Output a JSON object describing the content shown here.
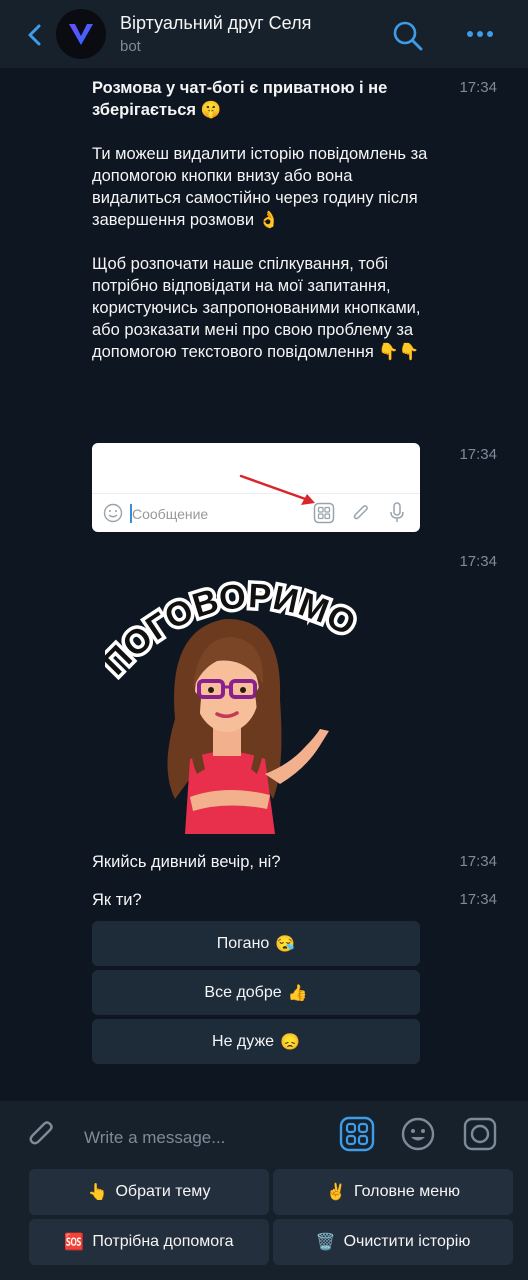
{
  "header": {
    "title": "Віртуальний друг Селя",
    "subtitle": "bot"
  },
  "messages": {
    "m1": {
      "bold_line": "Розмова у чат-боті є приватною і не зберігається 🤫",
      "para2": "Ти можеш видалити історію повідомлень за допомогою кнопки внизу або вона видалиться самостійно через годину після завершення розмови 👌",
      "para3": "Щоб розпочати наше спілкування, тобі потрібно відповідати на мої запитання, користуючись запропонованими кнопками, або розказати мені про свою проблему за допомогою текстового повідомлення 👇👇",
      "time": "17:34"
    },
    "screenshot": {
      "placeholder": "Сообщение",
      "time": "17:34"
    },
    "sticker": {
      "caption": "ПОГОВОРИМО?",
      "time": "17:34"
    },
    "m4": {
      "text": "Якийсь дивний вечір, ні?",
      "time": "17:34"
    },
    "m5": {
      "text": "Як ти?",
      "time": "17:34"
    }
  },
  "inline_keyboard": [
    {
      "label": "Погано",
      "emoji": "😪"
    },
    {
      "label": "Все добре",
      "emoji": "👍"
    },
    {
      "label": "Не дуже",
      "emoji": "😞"
    }
  ],
  "composer": {
    "placeholder": "Write a message..."
  },
  "reply_keyboard": [
    {
      "emoji": "👆",
      "label": "Обрати тему"
    },
    {
      "emoji": "✌️",
      "label": "Головне меню"
    },
    {
      "emoji": "🆘",
      "label": "Потрібна допомога"
    },
    {
      "emoji": "🗑️",
      "label": "Очистити історію"
    }
  ],
  "colors": {
    "accent": "#3e9ce8",
    "background": "#0e1621",
    "panel": "#17212b",
    "button": "#1e2c3a"
  }
}
